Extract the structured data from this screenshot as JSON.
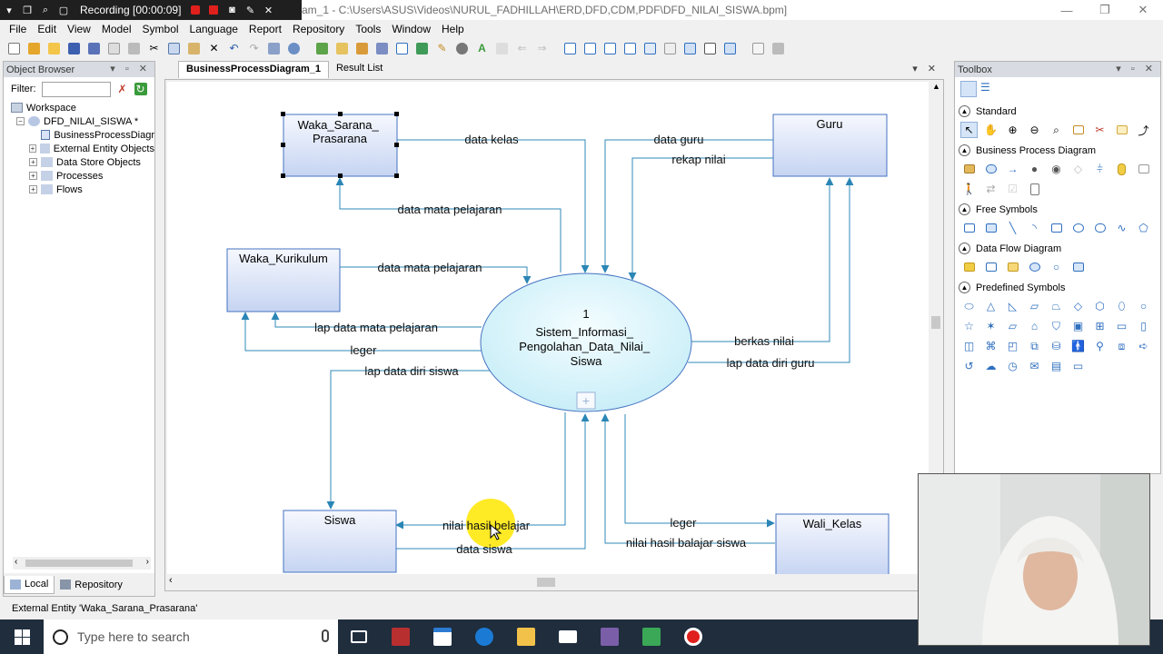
{
  "recorder": {
    "label": "Recording [00:00:09]"
  },
  "window": {
    "title": "am_1 - C:\\Users\\ASUS\\Videos\\NURUL_FADHILLAH\\ERD,DFD,CDM,PDF\\DFD_NILAI_SISWA.bpm]"
  },
  "menu": [
    "File",
    "Edit",
    "View",
    "Model",
    "Symbol",
    "Language",
    "Report",
    "Repository",
    "Tools",
    "Window",
    "Help"
  ],
  "object_browser": {
    "title": "Object Browser",
    "filter_label": "Filter:",
    "filter_value": "",
    "tree": {
      "root": "Workspace",
      "model": "DFD_NILAI_SISWA *",
      "children": [
        "BusinessProcessDiagr",
        "External Entity Objects",
        "Data Store Objects",
        "Processes",
        "Flows"
      ]
    },
    "tabs": {
      "local": "Local",
      "repository": "Repository"
    }
  },
  "doc_tabs": {
    "active": "BusinessProcessDiagram_1",
    "other": "Result List"
  },
  "diagram": {
    "entities": {
      "waka_sarana": "Waka_Sarana_\nPrasarana",
      "waka_sarana_l1": "Waka_Sarana_",
      "waka_sarana_l2": "Prasarana",
      "guru": "Guru",
      "waka_kurikulum": "Waka_Kurikulum",
      "siswa": "Siswa",
      "wali_kelas": "Wali_Kelas"
    },
    "process": {
      "number": "1",
      "line1": "Sistem_Informasi_",
      "line2": "Pengolahan_Data_Nilai_",
      "line3": "Siswa"
    },
    "flows": {
      "data_kelas": "data kelas",
      "data_guru": "data guru",
      "rekap_nilai": "rekap nilai",
      "data_mapel_1": "data mata pelajaran",
      "data_mapel_2": "data mata pelajaran",
      "lap_data_mapel": "lap data mata pelajaran",
      "leger_1": "leger",
      "lap_data_diri_siswa": "lap data diri siswa",
      "berkas_nilai": "berkas nilai",
      "lap_data_diri_guru": "lap data diri guru",
      "nilai_hasil_belajar": "nilai hasil belajar",
      "data_siswa": "data siswa",
      "leger_2": "leger",
      "nilai_hasil_balajar_siswa": "nilai hasil balajar siswa"
    },
    "colors": {
      "entity_top": "#f4f7fd",
      "entity_bottom": "#c9d6f3",
      "entity_border": "#3a6fc0",
      "process_fill": "#dcf6fb",
      "flow": "#2f8ab8"
    }
  },
  "toolbox": {
    "title": "Toolbox",
    "sections": [
      "Standard",
      "Business Process Diagram",
      "Free Symbols",
      "Data Flow Diagram",
      "Predefined Symbols"
    ]
  },
  "status": {
    "text": "External Entity 'Waka_Sarana_Prasarana'"
  },
  "taskbar": {
    "search_placeholder": "Type here to search"
  }
}
